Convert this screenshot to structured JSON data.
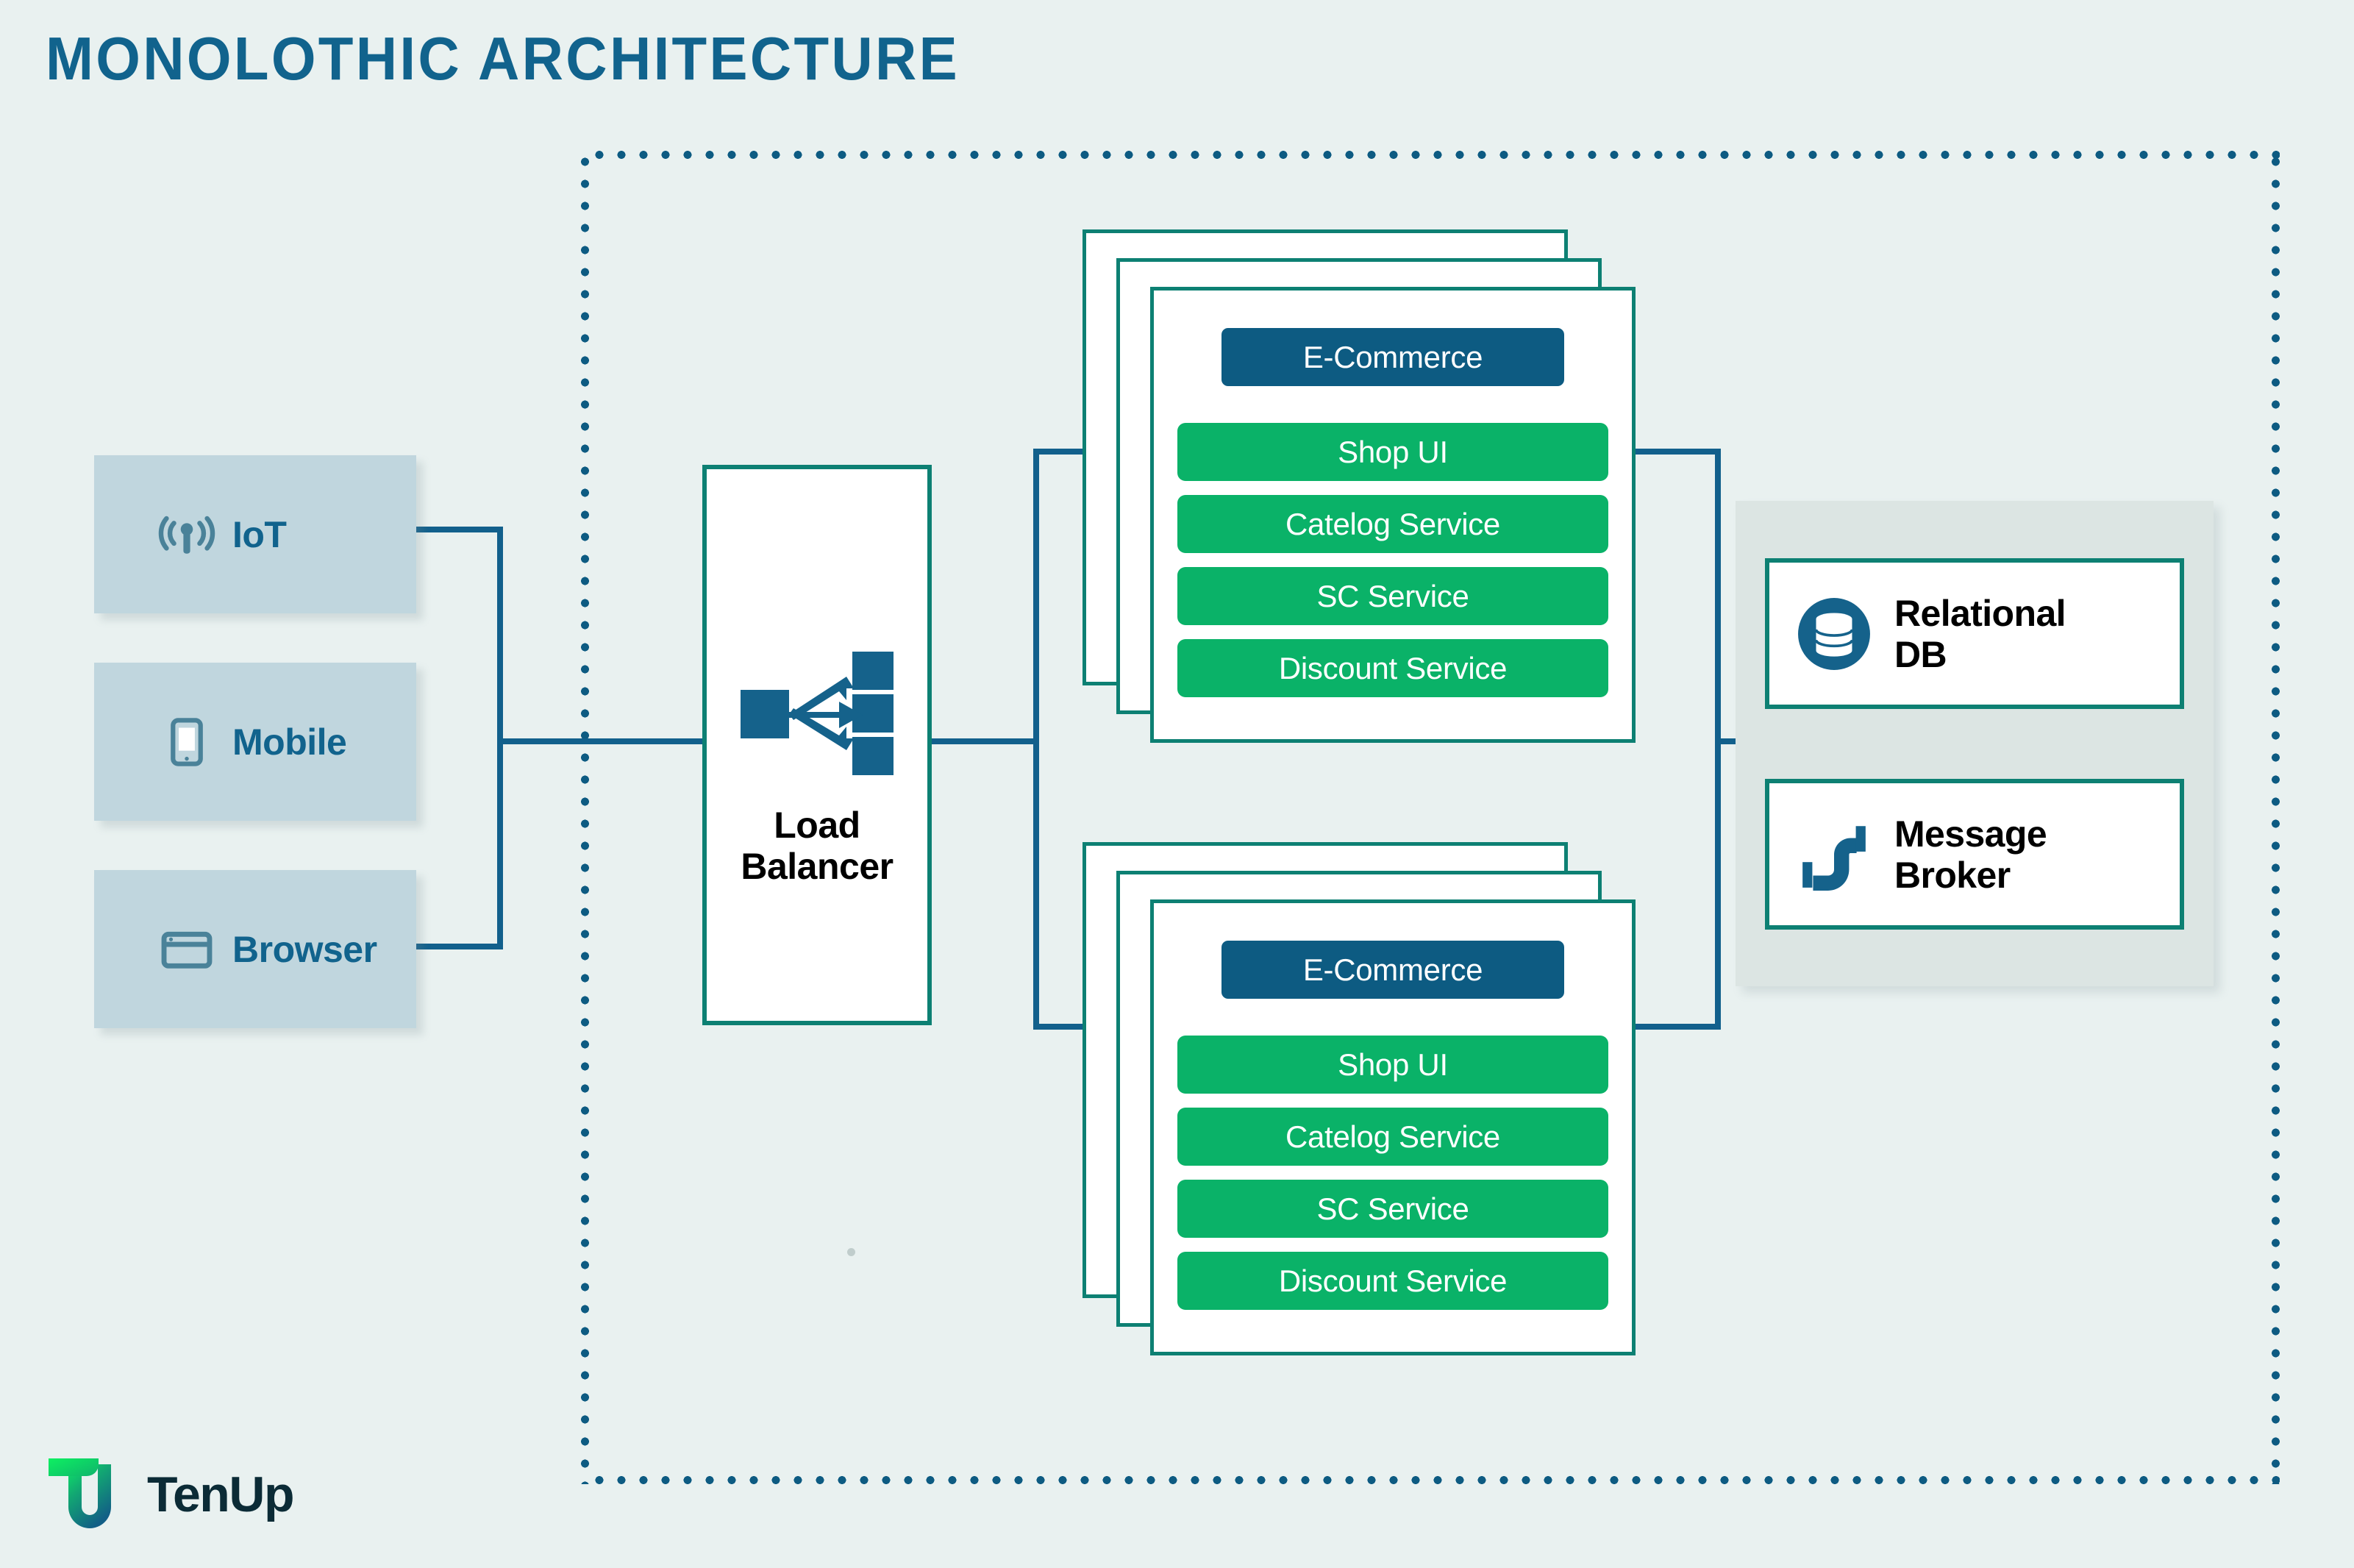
{
  "page": {
    "title": "MONOLOTHIC ARCHITECTURE",
    "background_color": "#e9f1f0"
  },
  "colors": {
    "title_blue": "#11638d",
    "wire_blue": "#12608c",
    "dotted_blue": "#0d5b82",
    "teal_border": "#0d8073",
    "service_green": "#0ab268",
    "ecommerce_blue": "#0d5b82",
    "client_box_fill": "#c0d6de",
    "client_icon": "#4a8299",
    "data_panel_fill": "#dce5e3",
    "icon_blue": "#15628b",
    "logo_green": "#0ed760",
    "logo_navy": "#0b2b36"
  },
  "clients": [
    {
      "label": "IoT",
      "icon": "iot-antenna-icon"
    },
    {
      "label": "Mobile",
      "icon": "mobile-device-icon"
    },
    {
      "label": "Browser",
      "icon": "browser-window-icon"
    }
  ],
  "load_balancer": {
    "label_line1": "Load",
    "label_line2": "Balancer",
    "icon": "load-balancer-fanout-icon"
  },
  "monoliths": [
    {
      "header": "E-Commerce",
      "services": [
        "Shop UI",
        "Catelog Service",
        "SC Service",
        "Discount Service"
      ],
      "instances": 3
    },
    {
      "header": "E-Commerce",
      "services": [
        "Shop UI",
        "Catelog Service",
        "SC Service",
        "Discount Service"
      ],
      "instances": 3
    }
  ],
  "data_layer": [
    {
      "label_line1": "Relational",
      "label_line2": "DB",
      "icon": "database-cylinder-icon"
    },
    {
      "label_line1": "Message",
      "label_line2": "Broker",
      "icon": "pipe-connector-icon"
    }
  ],
  "logo": {
    "text": "TenUp",
    "mark": "tenup-t-u-monogram-icon"
  }
}
